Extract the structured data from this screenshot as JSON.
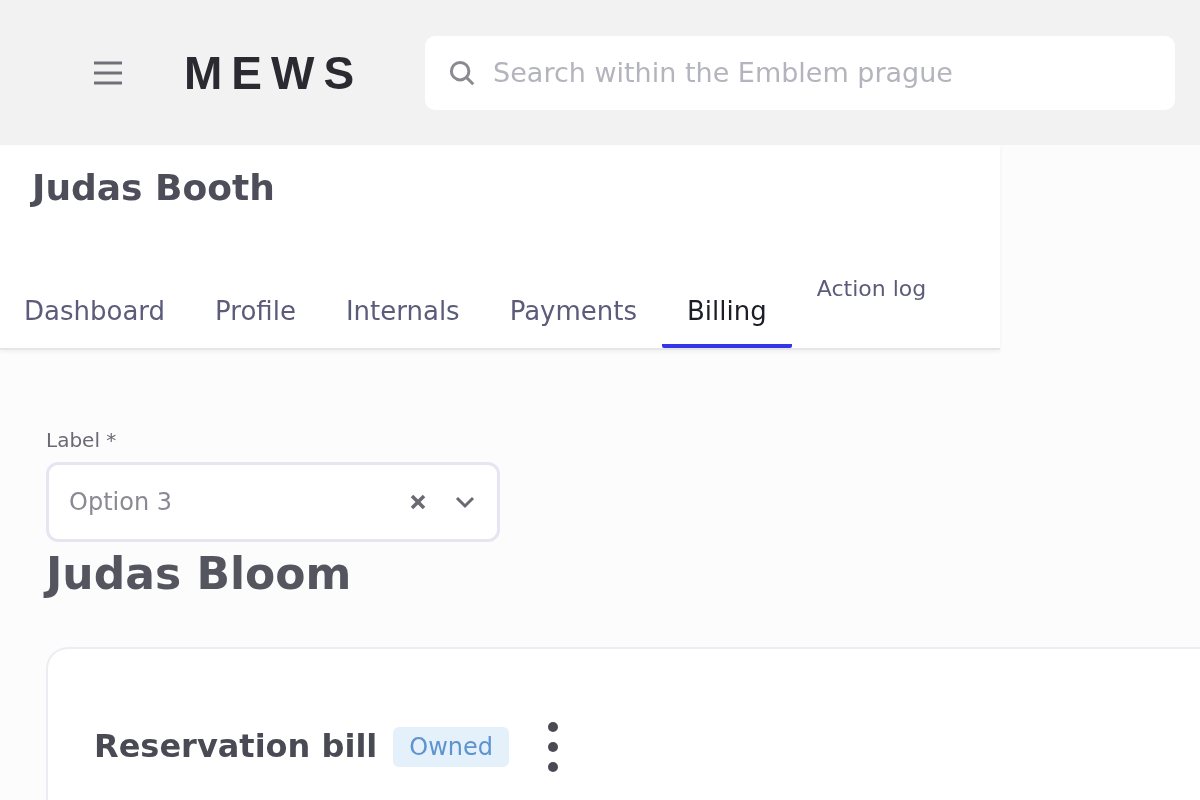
{
  "header": {
    "logo": "MEWS",
    "search": {
      "placeholder": "Search within the Emblem prague"
    }
  },
  "customer_name": "Judas Booth",
  "tabs": [
    {
      "label": "Dashboard",
      "selected": false,
      "kind": "main"
    },
    {
      "label": "Profile",
      "selected": false,
      "kind": "main"
    },
    {
      "label": "Internals",
      "selected": false,
      "kind": "main"
    },
    {
      "label": "Payments",
      "selected": false,
      "kind": "main"
    },
    {
      "label": "Billing",
      "selected": true,
      "kind": "main"
    },
    {
      "label": "Action log",
      "selected": false,
      "kind": "secondary"
    }
  ],
  "label_select": {
    "label": "Label",
    "required_mark": "*",
    "value": "Option 3"
  },
  "owner_name": "Judas Bloom",
  "bill": {
    "title": "Reservation bill",
    "badge": "Owned"
  }
}
